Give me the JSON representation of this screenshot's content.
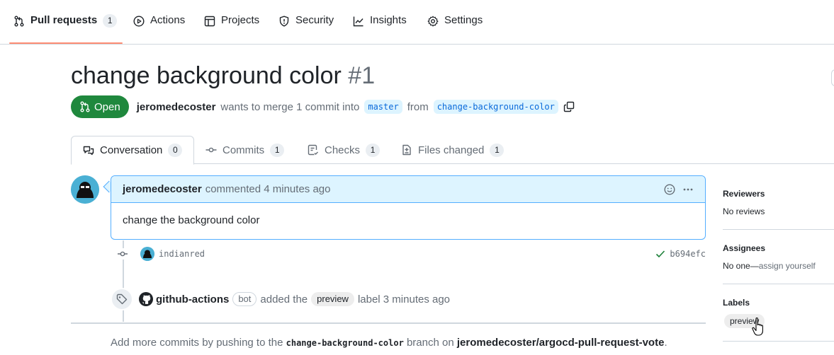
{
  "repo_nav": {
    "tabs": [
      {
        "label": "Pull requests",
        "count": "1",
        "icon": "git-pull-request-icon"
      },
      {
        "label": "Actions",
        "icon": "play-icon"
      },
      {
        "label": "Projects",
        "icon": "table-icon"
      },
      {
        "label": "Security",
        "icon": "shield-icon"
      },
      {
        "label": "Insights",
        "icon": "graph-icon"
      },
      {
        "label": "Settings",
        "icon": "gear-icon"
      }
    ]
  },
  "pr": {
    "title": "change background color",
    "number": "#1",
    "state": "Open",
    "author": "jeromedecoster",
    "meta_text": "wants to merge 1 commit into",
    "base_branch": "master",
    "from_text": "from",
    "head_branch": "change-background-color"
  },
  "pr_tabs": [
    {
      "label": "Conversation",
      "count": "0",
      "icon": "comment-discussion-icon"
    },
    {
      "label": "Commits",
      "count": "1",
      "icon": "git-commit-icon"
    },
    {
      "label": "Checks",
      "count": "1",
      "icon": "checklist-icon"
    },
    {
      "label": "Files changed",
      "count": "1",
      "icon": "file-diff-icon"
    }
  ],
  "comment": {
    "author": "jeromedecoster",
    "time": "commented 4 minutes ago",
    "body": "change the background color"
  },
  "commit": {
    "message": "indianred",
    "sha": "b694efc"
  },
  "label_event": {
    "actor": "github-actions",
    "bot": "bot",
    "pre": "added the",
    "label": "preview",
    "post": "label 3 minutes ago"
  },
  "push_hint": {
    "pre": "Add more commits by pushing to the",
    "branch": "change-background-color",
    "mid": "branch on",
    "repo": "jeromedecoster/argocd-pull-request-vote",
    "end": "."
  },
  "sidebar": {
    "reviewers": {
      "title": "Reviewers",
      "value": "No reviews"
    },
    "assignees": {
      "title": "Assignees",
      "value": "No one—",
      "link": "assign yourself"
    },
    "labels": {
      "title": "Labels",
      "value": "preview"
    }
  },
  "colors": {
    "open_green": "#1f883d",
    "accent_blue": "#0969da",
    "tab_underline": "#fd8c73"
  }
}
